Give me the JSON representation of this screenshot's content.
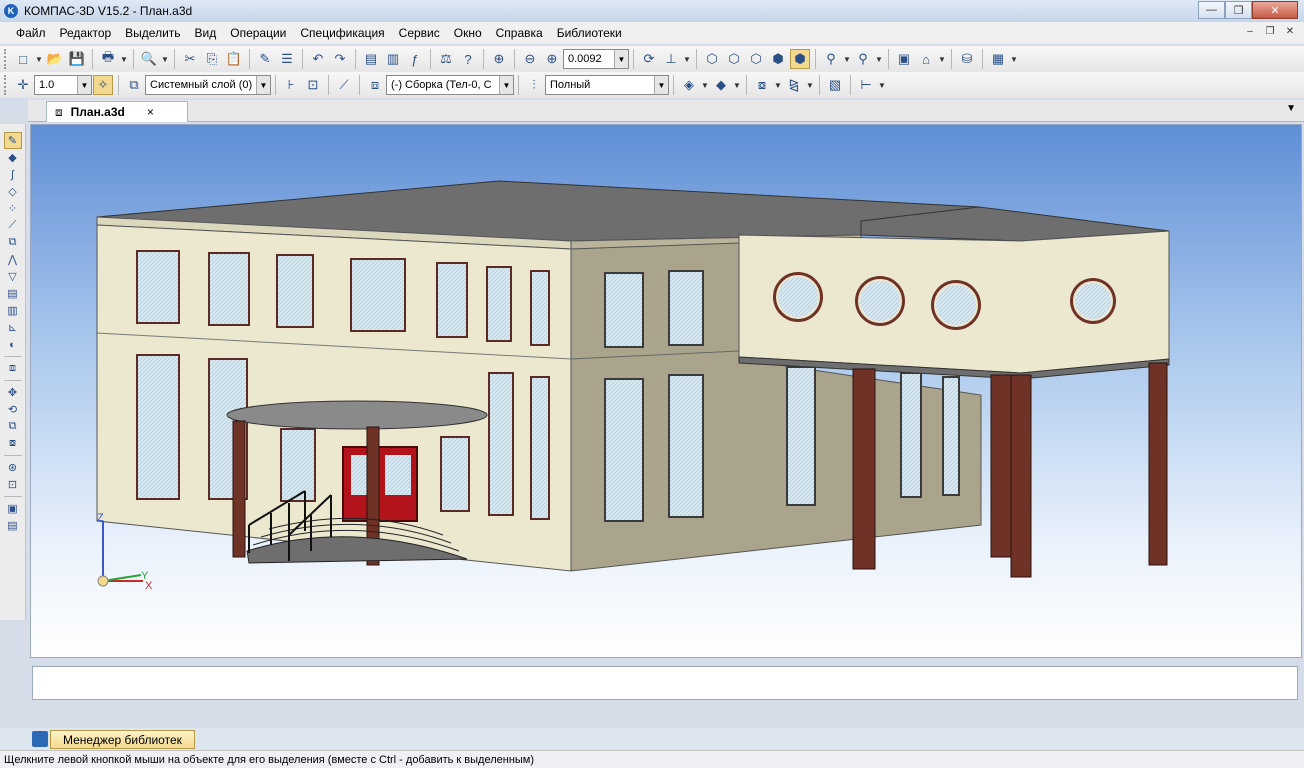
{
  "window": {
    "title": "КОМПАС-3D V15.2  - План.a3d",
    "logo_text": "K",
    "minimize": "—",
    "maximize": "❐",
    "close": "✕"
  },
  "menu": [
    "Файл",
    "Редактор",
    "Выделить",
    "Вид",
    "Операции",
    "Спецификация",
    "Сервис",
    "Окно",
    "Справка",
    "Библиотеки"
  ],
  "mdi": {
    "minimize": "–",
    "restore": "❐",
    "close": "✕"
  },
  "toolbar1": {
    "zoom_value": "0.0092"
  },
  "toolbar2": {
    "step_value": "1.0",
    "layer": "Системный слой (0)",
    "assembly": "(-) Сборка (Тел-0, С",
    "mode": "Полный"
  },
  "tab": {
    "label": "План.a3d",
    "close": "×"
  },
  "axes": {
    "z": "Z",
    "y": "Y",
    "x": "X"
  },
  "library": {
    "manager_label": "Менеджер библиотек"
  },
  "status": {
    "text": "Щелкните левой кнопкой мыши на объекте для его выделения (вместе с Ctrl - добавить к выделенным)"
  },
  "colors": {
    "facade_light": "#ece8cf",
    "facade_dark": "#a9a48b",
    "roof": "#6e6e6e",
    "columns": "#6e3226",
    "door": "#b3141c",
    "glass": "#d6e8f2"
  }
}
